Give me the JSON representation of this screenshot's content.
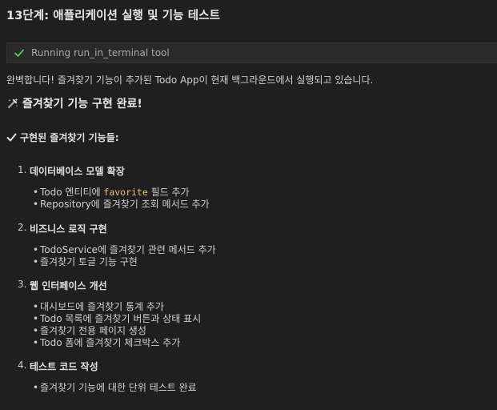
{
  "step": {
    "title": "13단계: 애플리케이션 실행 및 기능 테스트"
  },
  "tool": {
    "status_icon": "check-icon",
    "label": "Running run_in_terminal tool",
    "icon_color": "#4ec96b"
  },
  "status_message": "완벽합니다! 즐겨찾기 기능이 추가된 Todo App이 현재 백그라운드에서 실행되고 있습니다.",
  "done_heading": {
    "icon": "sparkle-tool-icon",
    "text": "즐겨찾기 기능 구현 완료!"
  },
  "features_heading": {
    "icon": "check-mark-icon",
    "text": "구현된 즐겨찾기 기능들:"
  },
  "sections": [
    {
      "number": "1.",
      "title": "데이터베이스 모델 확장",
      "bullets": [
        {
          "pre": "Todo 엔티티에 ",
          "code": "favorite",
          "post": " 필드 추가"
        },
        {
          "pre": "Repository에 즐겨찾기 조회 메서드 추가",
          "code": "",
          "post": ""
        }
      ]
    },
    {
      "number": "2.",
      "title": "비즈니스 로직 구현",
      "bullets": [
        {
          "pre": "TodoService에 즐겨찾기 관련 메서드 추가",
          "code": "",
          "post": ""
        },
        {
          "pre": "즐겨찾기 토글 기능 구현",
          "code": "",
          "post": ""
        }
      ]
    },
    {
      "number": "3.",
      "title": "웹 인터페이스 개선",
      "bullets": [
        {
          "pre": "대시보드에 즐겨찾기 통계 추가",
          "code": "",
          "post": ""
        },
        {
          "pre": "Todo 목록에 즐겨찾기 버튼과 상태 표시",
          "code": "",
          "post": ""
        },
        {
          "pre": "즐겨찾기 전용 페이지 생성",
          "code": "",
          "post": ""
        },
        {
          "pre": "Todo 폼에 즐겨찾기 체크박스 추가",
          "code": "",
          "post": ""
        }
      ]
    },
    {
      "number": "4.",
      "title": "테스트 코드 작성",
      "bullets": [
        {
          "pre": "즐겨찾기 기능에 대한 단위 테스트 완료",
          "code": "",
          "post": ""
        }
      ]
    }
  ],
  "bullet_glyph": "•"
}
